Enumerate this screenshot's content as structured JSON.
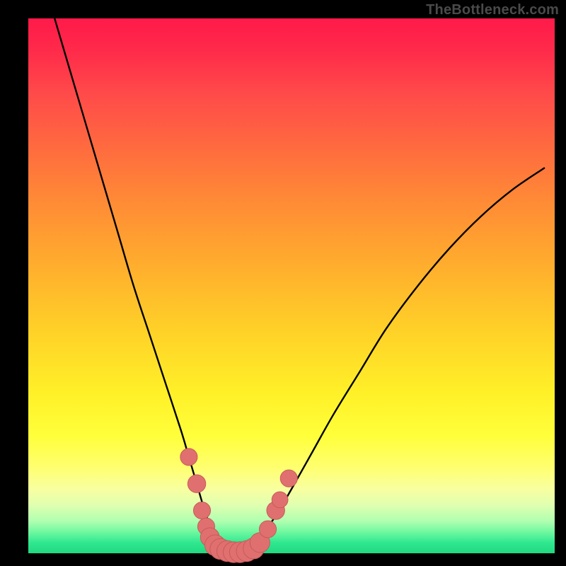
{
  "watermark": "TheBottleneck.com",
  "colors": {
    "background": "#000000",
    "curve": "#000000",
    "marker_fill": "#e07070",
    "marker_stroke": "#c85a5a"
  },
  "chart_data": {
    "type": "line",
    "title": "",
    "xlabel": "",
    "ylabel": "",
    "xlim": [
      0,
      100
    ],
    "ylim": [
      0,
      100
    ],
    "grid": false,
    "series": [
      {
        "name": "bottleneck-curve",
        "x": [
          5,
          8,
          11,
          14,
          17,
          20,
          23,
          26,
          29,
          30.5,
          32,
          33.5,
          35,
          36.5,
          38,
          40,
          42,
          44,
          47,
          50,
          54,
          58,
          63,
          68,
          74,
          80,
          86,
          92,
          98
        ],
        "y": [
          100,
          90,
          80,
          70,
          60,
          50,
          41,
          32,
          23,
          18,
          13,
          8,
          4,
          2,
          0.5,
          0,
          1,
          3,
          7,
          12,
          19,
          26,
          34,
          42,
          50,
          57,
          63,
          68,
          72
        ]
      }
    ],
    "markers": [
      {
        "x": 30.5,
        "y": 18,
        "r": 1.2
      },
      {
        "x": 32.0,
        "y": 13,
        "r": 1.3
      },
      {
        "x": 33.0,
        "y": 8,
        "r": 1.2
      },
      {
        "x": 33.8,
        "y": 5,
        "r": 1.2
      },
      {
        "x": 34.5,
        "y": 3,
        "r": 1.4
      },
      {
        "x": 35.5,
        "y": 1.5,
        "r": 1.6
      },
      {
        "x": 36.5,
        "y": 0.8,
        "r": 1.6
      },
      {
        "x": 37.8,
        "y": 0.4,
        "r": 1.6
      },
      {
        "x": 39.0,
        "y": 0.2,
        "r": 1.6
      },
      {
        "x": 40.2,
        "y": 0.2,
        "r": 1.6
      },
      {
        "x": 41.5,
        "y": 0.4,
        "r": 1.6
      },
      {
        "x": 42.8,
        "y": 0.9,
        "r": 1.6
      },
      {
        "x": 44.0,
        "y": 2.0,
        "r": 1.5
      },
      {
        "x": 45.5,
        "y": 4.5,
        "r": 1.2
      },
      {
        "x": 47.0,
        "y": 8.0,
        "r": 1.3
      },
      {
        "x": 47.8,
        "y": 10.0,
        "r": 1.1
      },
      {
        "x": 49.5,
        "y": 14.0,
        "r": 1.2
      }
    ]
  }
}
